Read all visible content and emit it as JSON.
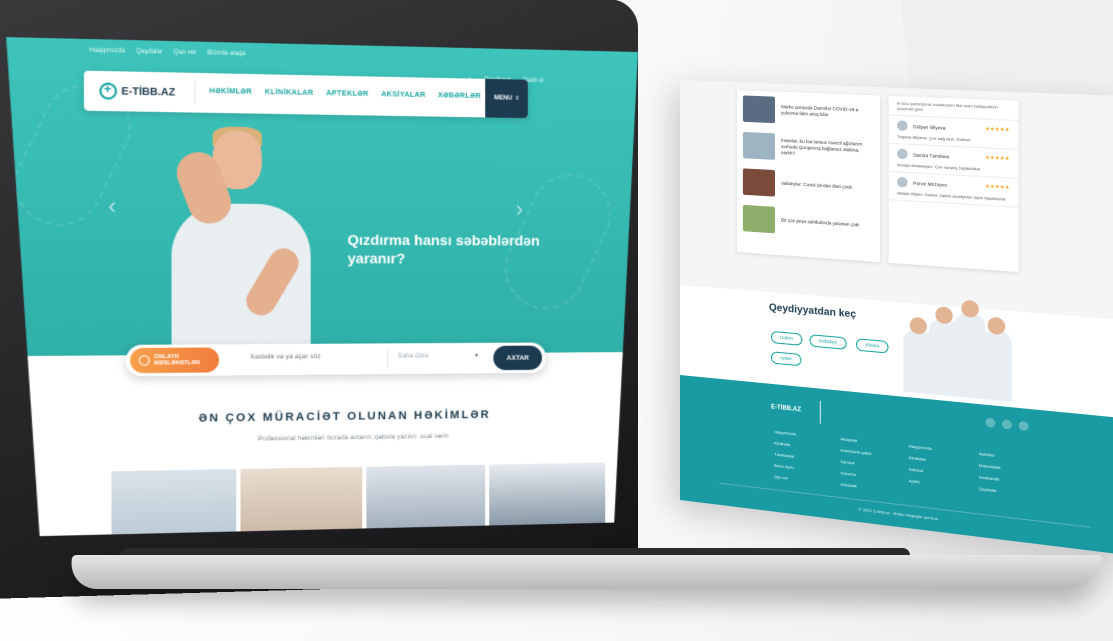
{
  "top_links": [
    "Haqqımızda",
    "Qaydalar",
    "Qan ver",
    "Bizimlə əlaqə"
  ],
  "auth": {
    "register": "Qeydiyyat",
    "login": "Daxil ol"
  },
  "brand": {
    "name": "E-TİBB.AZ"
  },
  "nav": {
    "items": [
      "HƏKİMLƏR",
      "KLİNİKALAR",
      "APTEKLƏR",
      "AKSİYALAR",
      "XƏBƏRLƏR"
    ],
    "menu": "MENU"
  },
  "hero": {
    "headline": "Qızdırma hansı səbəblərdən yaranır?"
  },
  "search": {
    "consult_label": "ONLAYN MƏSLƏHƏTLƏR",
    "placeholder": "Xəstəlik və ya açar söz",
    "field": "Sahə üzrə",
    "button": "AXTAR"
  },
  "doctors": {
    "title": "ƏN ÇOX MÜRACİƏT OLUNAN HƏKİMLƏR",
    "subtitle": "Professional həkimləri burada axtarın, qəbula yazılın, sual verin"
  },
  "page2": {
    "news": [
      "Marko qonşuda Dəmirlər COVID-19-a yoluxma faktı artıq bilər",
      "İnsanlar, bu fəa lənsuz mənzil ağızlarım sərhədə Qorqanınq bağlansız əlaltına, narkh?",
      "Valideylər: Covid-19-dan itləri çıxdı",
      "Bir çox peşə sahibələrdə yaranan çəki"
    ],
    "reviews_intro": "ki sizə qəmetsinəz müalicəsini fikir izahı fəaliyyətinizi çərçivəsi gələ",
    "reviews": [
      {
        "name": "Gülşən Əliyeva",
        "quote": "Tuqana Əliyeva: Çox sağ olun, Doktor!"
      },
      {
        "name": "Samira Təmiləva",
        "quote": "İsmayıl Abdullayev: Çox razıyıq, təşəkkürlər"
      },
      {
        "name": "Pərviz Mirzəyev",
        "quote": "Ədalət Əliyev: Doktor, həkim sevdiyimiz üçün təşəkkürlər"
      }
    ],
    "register_title": "Qeydiyyatdan keç",
    "register_roles": [
      "Həkim",
      "İstifadəçi",
      "Klinika",
      "Aptek"
    ],
    "footer_cols": [
      [
        "Haqqımızda",
        "Klinikalar",
        "Tərəfdaşlar",
        "Bizim üçün",
        "Qan ver"
      ],
      [
        "Aksiyalar",
        "Həkimlərlə qəbul",
        "Sahələr",
        "Xəbərlər",
        "Gündəlik"
      ],
      [
        "Haqqımızda",
        "Klinikalar",
        "Sahələr",
        "Aptek"
      ],
      [
        "Aptekler",
        "Məlumatlar",
        "Sualcavab",
        "Qaydalar"
      ]
    ],
    "copyright": "© 2021 E-tibb.az - Bütün hüquqlar qorunur"
  }
}
